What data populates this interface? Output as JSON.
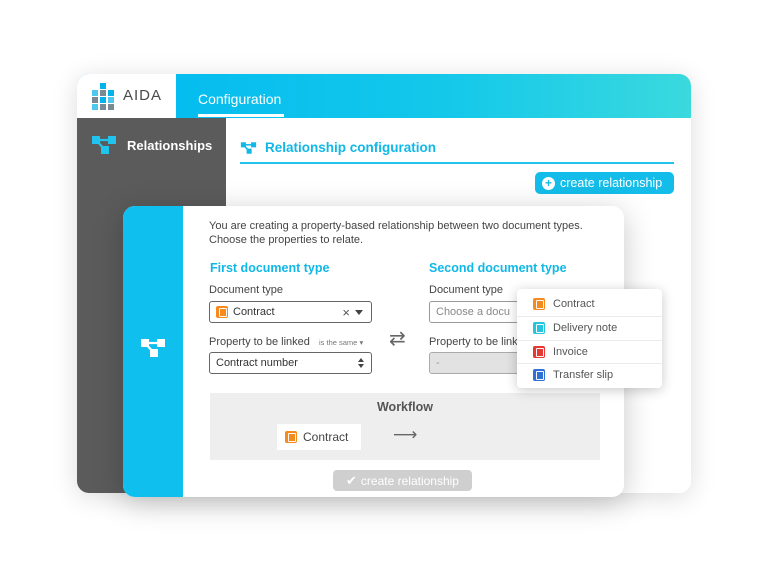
{
  "app": {
    "logo_text": "AIDA",
    "active_tab": "Configuration"
  },
  "sidebar": {
    "items": [
      {
        "label": "Relationships",
        "icon": "relationship-icon"
      }
    ]
  },
  "main": {
    "section_title": "Relationship configuration",
    "create_button_label": "create relationship"
  },
  "modal": {
    "intro_line1": "You are creating a property-based relationship between two document types.",
    "intro_line2": "Choose the properties to relate.",
    "first": {
      "title": "First document type",
      "doc_type_label": "Document type",
      "doc_type_value": "Contract",
      "doc_type_icon": "contract-icon",
      "property_label": "Property to be linked",
      "relation_note": "is the same",
      "property_value": "Contract number"
    },
    "second": {
      "title": "Second document type",
      "doc_type_label": "Document type",
      "doc_type_placeholder": "Choose a docu",
      "property_label": "Property to be link",
      "property_value": "-"
    },
    "workflow": {
      "title": "Workflow",
      "node_label": "Contract",
      "arrow": "⟶"
    },
    "submit_label": "create relationship"
  },
  "dropdown": {
    "options": [
      {
        "label": "Contract",
        "icon": "contract-icon",
        "color": "#f58a1f"
      },
      {
        "label": "Delivery note",
        "icon": "delivery-truck-icon",
        "color": "#27c4dd"
      },
      {
        "label": "Invoice",
        "icon": "invoice-icon",
        "color": "#e53935"
      },
      {
        "label": "Transfer slip",
        "icon": "bank-icon",
        "color": "#2f6fd6"
      }
    ]
  },
  "colors": {
    "accent": "#10b8e8",
    "sidebar_bg": "#5b5b5b",
    "contract_orange": "#f58a1f"
  }
}
